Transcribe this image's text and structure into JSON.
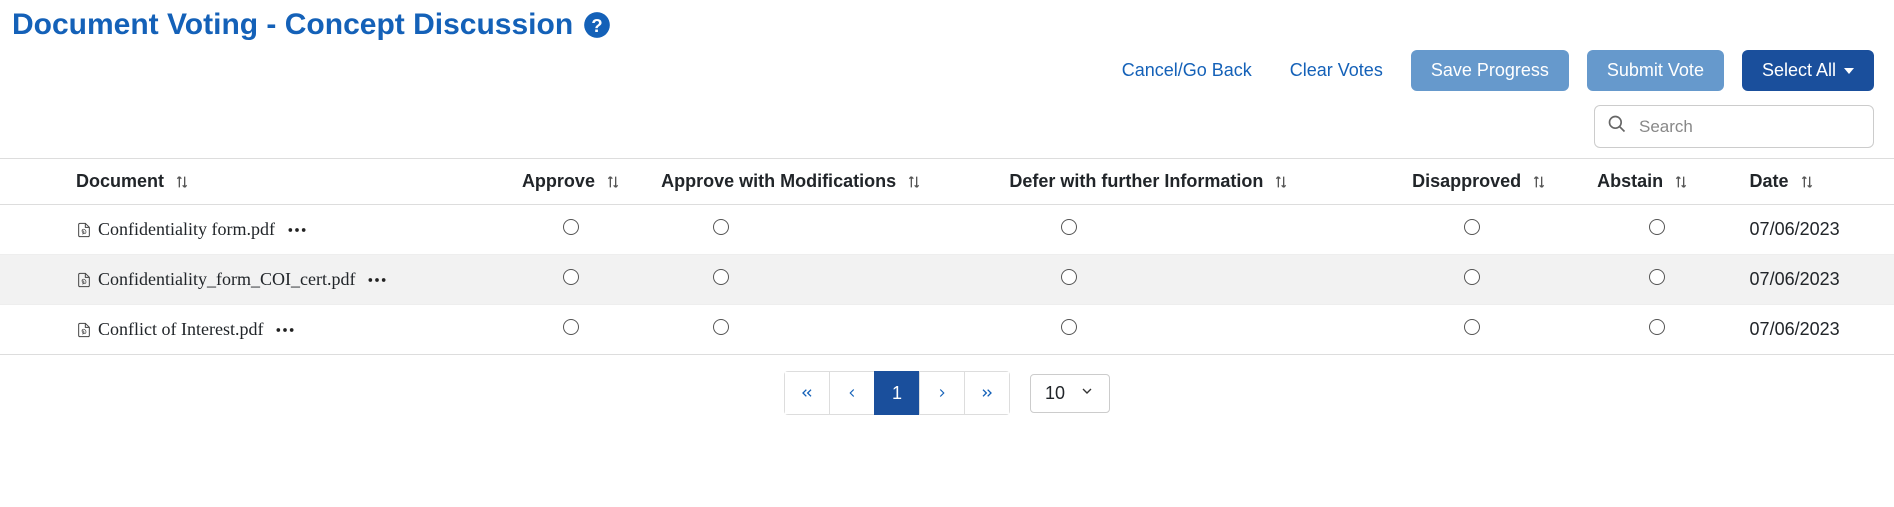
{
  "page": {
    "title": "Document Voting - Concept Discussion"
  },
  "toolbar": {
    "cancel": "Cancel/Go Back",
    "clear": "Clear Votes",
    "save": "Save Progress",
    "submit": "Submit Vote",
    "select_all": "Select All"
  },
  "search": {
    "placeholder": "Search",
    "value": ""
  },
  "table": {
    "columns": {
      "document": "Document",
      "approve": "Approve",
      "approve_mod": "Approve with Modifications",
      "defer": "Defer with further Information",
      "disapproved": "Disapproved",
      "abstain": "Abstain",
      "date": "Date"
    },
    "rows": [
      {
        "name": "Confidentiality form.pdf",
        "date": "07/06/2023"
      },
      {
        "name": "Confidentiality_form_COI_cert.pdf",
        "date": "07/06/2023"
      },
      {
        "name": "Conflict of Interest.pdf",
        "date": "07/06/2023"
      }
    ]
  },
  "pagination": {
    "current": "1",
    "page_size": "10"
  }
}
